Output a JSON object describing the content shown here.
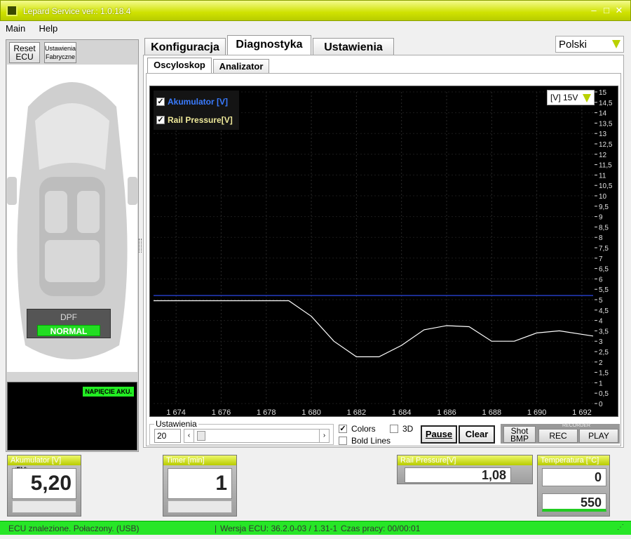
{
  "window": {
    "title": "Lepard Service  ver.: 1.0.18.4",
    "min": "–",
    "max": "□",
    "close": "✕"
  },
  "menu": [
    "Main",
    "Help"
  ],
  "left": {
    "reset_btn": "Reset ECU",
    "factory_btn": "Ustawienia Fabryczne",
    "dpf_label": "DPF",
    "dpf_status": "NORMAL",
    "mini_label": "NAPIĘCIE AKU."
  },
  "tabs": [
    "Konfiguracja",
    "Diagnostyka",
    "Ustawienia"
  ],
  "subtabs": [
    "Oscyloskop",
    "Analizator"
  ],
  "language": "Polski",
  "scope": {
    "legend": [
      "Akumulator [V]",
      "Rail Pressure[V]"
    ],
    "range": "[V] 15V",
    "settings_label": "Ustawienia",
    "settings_value": "20",
    "colors_label": "Colors",
    "bold_label": "Bold Lines",
    "threed_label": "3D",
    "pause_btn": "Pause",
    "clear_btn": "Clear",
    "shot_btn": "Shot BMP",
    "recorder_label": "RECORDER",
    "rec_btn": "REC",
    "play_btn": "PLAY"
  },
  "gauges": {
    "akumulator": {
      "title": "Akumulator [V]",
      "badge": "<5V>",
      "value": "5,20"
    },
    "timer": {
      "title": "Timer [min]",
      "value": "1"
    },
    "rail": {
      "title": "Rail Pressure[V]",
      "value": "1,08"
    },
    "temperatura": {
      "title": "Temperatura [°C]",
      "value1": "0",
      "value2": "550"
    }
  },
  "status": {
    "left": "ECU znalezione. Połaczony. (USB)",
    "version": "Wersja ECU: 36.2.0-03 / 1.31-1",
    "time": "Czas pracy: 00/00:01"
  },
  "chart_data": {
    "type": "line",
    "x_ticks": [
      "1 674",
      "1 676",
      "1 678",
      "1 680",
      "1 682",
      "1 684",
      "1 686",
      "1 688",
      "1 690",
      "1 692"
    ],
    "y_ticks": [
      "0",
      "0,5",
      "1",
      "1,5",
      "2",
      "2,5",
      "3",
      "3,5",
      "4",
      "4,5",
      "5",
      "5,5",
      "6",
      "6,5",
      "7",
      "7,5",
      "8",
      "8,5",
      "9",
      "9,5",
      "10",
      "10,5",
      "11",
      "11,5",
      "12",
      "12,5",
      "13",
      "13,5",
      "14",
      "14,5",
      "15"
    ],
    "xlim": [
      1673,
      1692.5
    ],
    "ylim": [
      0,
      15
    ],
    "series": [
      {
        "name": "Akumulator [V]",
        "color": "#3050ff",
        "x": [
          1673,
          1692.5
        ],
        "y": [
          5.2,
          5.2
        ]
      },
      {
        "name": "Rail Pressure[V]",
        "color": "#ffffff",
        "x": [
          1673,
          1679,
          1680,
          1681,
          1682,
          1683,
          1684,
          1685,
          1686,
          1687,
          1688,
          1689,
          1690,
          1691,
          1692.5
        ],
        "y": [
          4.95,
          4.95,
          4.2,
          3.0,
          2.25,
          2.25,
          2.8,
          3.55,
          3.75,
          3.7,
          3.0,
          3.0,
          3.4,
          3.5,
          3.25
        ]
      }
    ],
    "grid": true
  },
  "colors": {
    "accent": "#c8dc00",
    "status_green": "#27e627"
  }
}
